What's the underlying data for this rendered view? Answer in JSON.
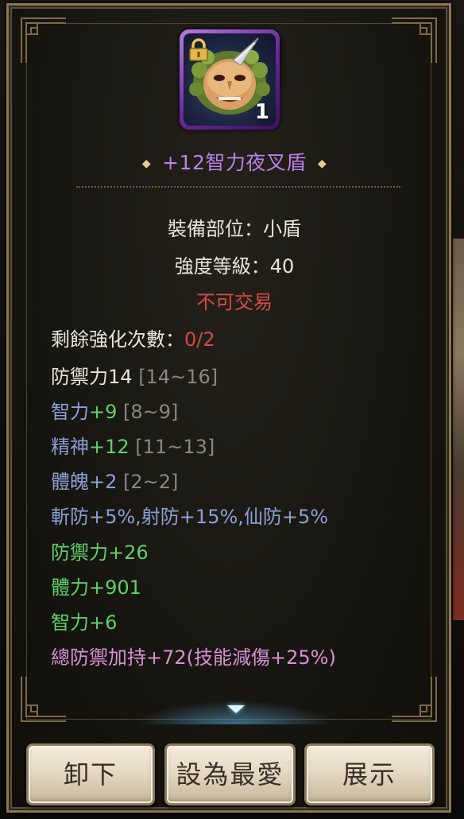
{
  "item": {
    "name": "+12智力夜叉盾",
    "count": "1",
    "icon": "demon-mask-shield-icon",
    "locked": true,
    "rarity_color": "#b97fe8"
  },
  "info": {
    "slot": "裝備部位：小盾",
    "level": "強度等級：40",
    "trade": "不可交易"
  },
  "stats": {
    "refine_label": "剩餘強化次數：",
    "refine_value": "0/2",
    "defense": {
      "label": "防禦力14",
      "range": "[14~16]"
    },
    "int": {
      "label": "智力",
      "value": "+9",
      "range": "[8~9]"
    },
    "spirit": {
      "label": "精神",
      "value": "+12",
      "range": "[11~13]"
    },
    "body": {
      "label": "體魄+2",
      "range": "[2~2]"
    },
    "resist": "斬防+5%,射防+15%,仙防+5%",
    "bonus_defense": "防禦力+26",
    "bonus_hp": "體力+901",
    "bonus_int": "智力+6",
    "set_bonus": "總防禦加持+72(技能減傷+25%)"
  },
  "buttons": {
    "unequip": "卸下",
    "favorite": "設為最愛",
    "show": "展示"
  },
  "colors": {
    "frame": "#8c7752",
    "red": "#d64a45",
    "blue": "#8a9fd6",
    "green": "#5fd06b",
    "pink": "#d78fd6",
    "gray": "#8a8680"
  }
}
